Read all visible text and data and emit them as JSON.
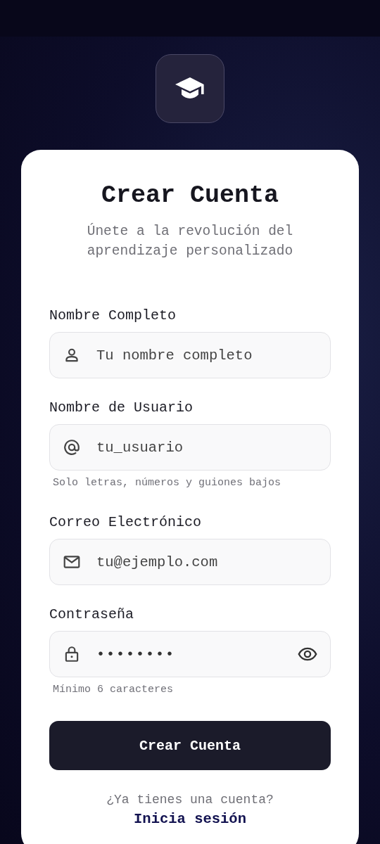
{
  "header": {
    "title": "Crear Cuenta",
    "subtitle": "Únete a la revolución del aprendizaje personalizado"
  },
  "fields": [
    {
      "kind": "name",
      "label": "Nombre Completo",
      "placeholder": "Tu nombre completo"
    },
    {
      "kind": "username",
      "label": "Nombre de Usuario",
      "placeholder": "tu_usuario",
      "hint": "Solo letras, números y guiones bajos"
    },
    {
      "kind": "email",
      "label": "Correo Electrónico",
      "placeholder": "tu@ejemplo.com"
    },
    {
      "kind": "password",
      "label": "Contraseña",
      "value": "••••••••",
      "hint": "Mínimo 6 caracteres"
    }
  ],
  "submit_button": "Crear Cuenta",
  "footer": {
    "prompt": "¿Ya tienes una cuenta?",
    "link": "Inicia sesión"
  }
}
